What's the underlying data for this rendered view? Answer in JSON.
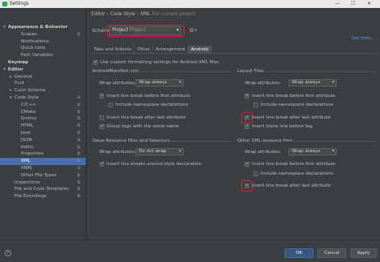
{
  "window": {
    "title": "Settings",
    "minimize": "—",
    "maximize": "☐",
    "close": "✕"
  },
  "sidebar": {
    "items": [
      {
        "label": "Appearance & Behavior",
        "level": 0,
        "arrow": "▾",
        "bold": true
      },
      {
        "label": "Scopes",
        "level": 2,
        "cp": true
      },
      {
        "label": "Notifications",
        "level": 2
      },
      {
        "label": "Quick Lists",
        "level": 2
      },
      {
        "label": "Path Variables",
        "level": 2
      },
      {
        "label": "Keymap",
        "level": 0,
        "bold": true
      },
      {
        "label": "Editor",
        "level": 0,
        "arrow": "▾",
        "bold": true
      },
      {
        "label": "General",
        "level": 1,
        "arrow": "▸"
      },
      {
        "label": "Font",
        "level": 1
      },
      {
        "label": "Color Scheme",
        "level": 1,
        "arrow": "▸"
      },
      {
        "label": "Code Style",
        "level": 1,
        "arrow": "▾",
        "cp": true
      },
      {
        "label": "C/C++",
        "level": 2,
        "cp": true
      },
      {
        "label": "CMake",
        "level": 2,
        "cp": true
      },
      {
        "label": "Groovy",
        "level": 2,
        "cp": true
      },
      {
        "label": "HTML",
        "level": 2,
        "cp": true
      },
      {
        "label": "Java",
        "level": 2,
        "cp": true
      },
      {
        "label": "JSON",
        "level": 2,
        "cp": true
      },
      {
        "label": "Kotlin",
        "level": 2,
        "cp": true
      },
      {
        "label": "Properties",
        "level": 2,
        "cp": true
      },
      {
        "label": "XML",
        "level": 2,
        "cp": true,
        "selected": true
      },
      {
        "label": "YAML",
        "level": 2,
        "cp": true
      },
      {
        "label": "Other File Types",
        "level": 2,
        "cp": true
      },
      {
        "label": "Inspections",
        "level": 1,
        "cp": true
      },
      {
        "label": "File and Code Templates",
        "level": 1,
        "cp": true
      },
      {
        "label": "File Encodings",
        "level": 1,
        "cp": true
      }
    ]
  },
  "breadcrumb": {
    "part1": "Editor",
    "part2": "Code Style",
    "part3": "XML",
    "note": "For current project"
  },
  "scheme": {
    "label": "Scheme:",
    "value": "Project",
    "sub": "Project"
  },
  "set_from": "Set from...",
  "tabs": [
    "Tabs and Indents",
    "Other",
    "Arrangement",
    "Android"
  ],
  "use_custom": "Use custom formatting settings for Android XML files",
  "manifest": {
    "title": "AndroidManifest.xml",
    "wrap_label": "Wrap attributes:",
    "wrap_value": "Wrap always",
    "insert_before_first": "Insert line break before first attribute",
    "include_ns": "Include namespace declarations",
    "insert_after_last": "Insert line break after last attribute",
    "group_tags": "Group tags with the same name"
  },
  "layout": {
    "title": "Layout Files",
    "wrap_label": "Wrap attributes:",
    "wrap_value": "Wrap always",
    "insert_before_first": "Insert line break before first attribute",
    "include_ns": "Include namespace declarations",
    "insert_after_last": "Insert line break after last attribute",
    "insert_blank": "Insert blank line before tag"
  },
  "values": {
    "title": "Value Resource Files and Selectors",
    "wrap_label": "Wrap attributes:",
    "wrap_value": "Do not wrap",
    "insert_around": "Insert line breaks around style declaration"
  },
  "other": {
    "title": "Other XML resource files",
    "wrap_label": "Wrap attributes:",
    "wrap_value": "Wrap always",
    "insert_before_first": "Insert line break before first attribute",
    "include_ns": "Include namespace declarations",
    "insert_after_last": "Insert line break after last attribute"
  },
  "buttons": {
    "ok": "OK",
    "cancel": "Cancel",
    "apply": "Apply",
    "help": "?"
  },
  "colors": {
    "highlight": "#e0203a",
    "selection": "#4b6eaf",
    "link": "#589df6"
  }
}
